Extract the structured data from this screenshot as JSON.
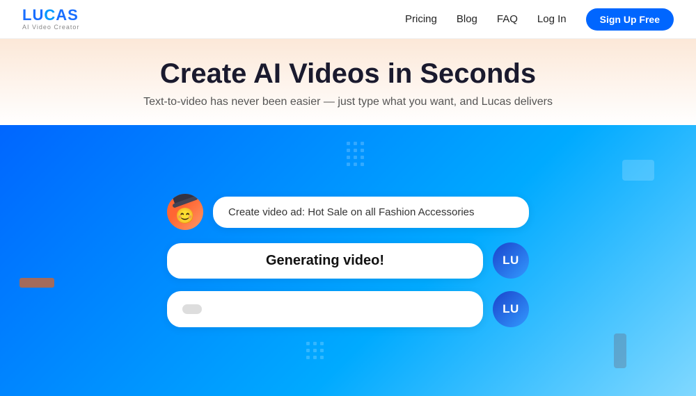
{
  "logo": {
    "text": "LUCAS",
    "subtitle": "AI Video Creator"
  },
  "nav": {
    "links": [
      {
        "label": "Pricing",
        "id": "pricing"
      },
      {
        "label": "Blog",
        "id": "blog"
      },
      {
        "label": "FAQ",
        "id": "faq"
      },
      {
        "label": "Log In",
        "id": "login"
      }
    ],
    "cta": "Sign Up Free"
  },
  "hero": {
    "title": "Create AI Videos in Seconds",
    "subtitle": "Text-to-video has never been easier — just type what you want, and Lucas delivers"
  },
  "chat": {
    "user_message": "Create video ad: Hot Sale on all Fashion Accessories",
    "bot_message": "Generating video!",
    "bot_avatar_label": "LU",
    "input_placeholder": ""
  }
}
